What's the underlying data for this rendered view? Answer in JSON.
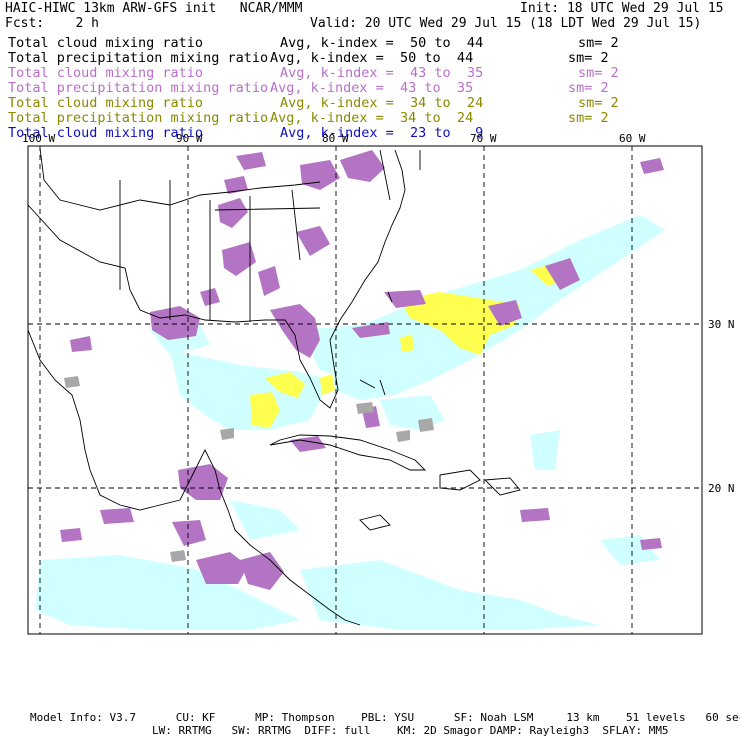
{
  "header": {
    "left_title": "HAIC-HIWC 13km ARW-GFS init   NCAR/MMM",
    "init": "Init: 18 UTC Wed 29 Jul 15",
    "fcst": "Fcst:    2 h",
    "valid": "Valid: 20 UTC Wed 29 Jul 15 (18 LDT Wed 29 Jul 15)"
  },
  "legend_rows": [
    {
      "field": "Total cloud mixing ratio",
      "range": "Avg, k-index =  50 to  44",
      "sm": "sm= 2",
      "color": "#000000"
    },
    {
      "field": "Total precipitation mixing ratio",
      "range": "Avg, k-index =  50 to  44",
      "sm": "sm= 2",
      "color": "#000000"
    },
    {
      "field": "Total cloud mixing ratio",
      "range": "Avg, k-index =  43 to  35",
      "sm": "sm= 2",
      "color": "#b870c8"
    },
    {
      "field": "Total precipitation mixing ratio",
      "range": "Avg, k-index =  43 to  35",
      "sm": "sm= 2",
      "color": "#b870c8"
    },
    {
      "field": "Total cloud mixing ratio",
      "range": "Avg, k-index =  34 to  24",
      "sm": "sm= 2",
      "color": "#8a8a00"
    },
    {
      "field": "Total precipitation mixing ratio",
      "range": "Avg, k-index =  34 to  24",
      "sm": "sm= 2",
      "color": "#8a8a00"
    },
    {
      "field": "Total cloud mixing ratio",
      "range": "Avg, k-index =  23 to   9",
      "sm": "",
      "color": "#1010c0"
    }
  ],
  "longitude_labels": [
    "100 W",
    "90 W",
    "80 W",
    "70 W",
    "60 W"
  ],
  "latitude_labels": [
    "30 N",
    "20 N"
  ],
  "colors": {
    "purple_fill": "#b474c4",
    "yellow_fill": "#ffff50",
    "cyan_fill": "#cfffff",
    "gray_fill": "#a8a8a8"
  },
  "footer": {
    "line1": "Model Info: V3.7      CU: KF      MP: Thompson    PBL: YSU      SF: Noah LSM     13 km    51 levels   60 sec",
    "line2": "LW: RRTMG   SW: RRTMG  DIFF: full    KM: 2D Smagor DAMP: Rayleigh3  SFLAY: MM5"
  }
}
